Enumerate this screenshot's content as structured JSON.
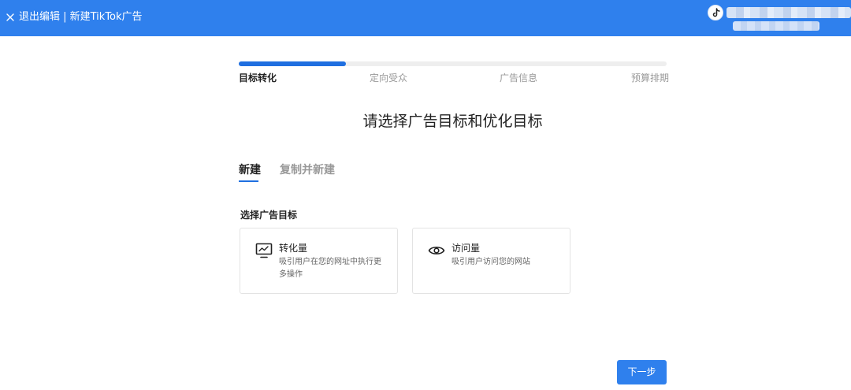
{
  "header": {
    "title": "退出编辑 | 新建TikTok广告",
    "close_icon": "close-icon",
    "platform_icon": "tiktok-logo-icon"
  },
  "steps": [
    {
      "label": "目标转化",
      "active": true
    },
    {
      "label": "定向受众",
      "active": false
    },
    {
      "label": "广告信息",
      "active": false
    },
    {
      "label": "预算排期",
      "active": false
    }
  ],
  "progress": {
    "current_step": 1,
    "total_steps": 4,
    "fill_fraction": 0.25
  },
  "page": {
    "heading": "请选择广告目标和优化目标"
  },
  "tabs": [
    {
      "label": "新建",
      "active": true
    },
    {
      "label": "复制并新建",
      "active": false
    }
  ],
  "objective": {
    "section_label": "选择广告目标",
    "cards": [
      {
        "title": "转化量",
        "description": "吸引用户在您的网址中执行更多操作",
        "icon": "monitor-chart-icon"
      },
      {
        "title": "访问量",
        "description": "吸引用户访问您的网站",
        "icon": "eye-icon"
      }
    ]
  },
  "footer": {
    "next_label": "下一步"
  },
  "colors": {
    "brand_blue": "#2f80ed",
    "progress_blue": "#1f6fe0",
    "muted_text": "#999999",
    "card_border": "#e3e3e3"
  }
}
